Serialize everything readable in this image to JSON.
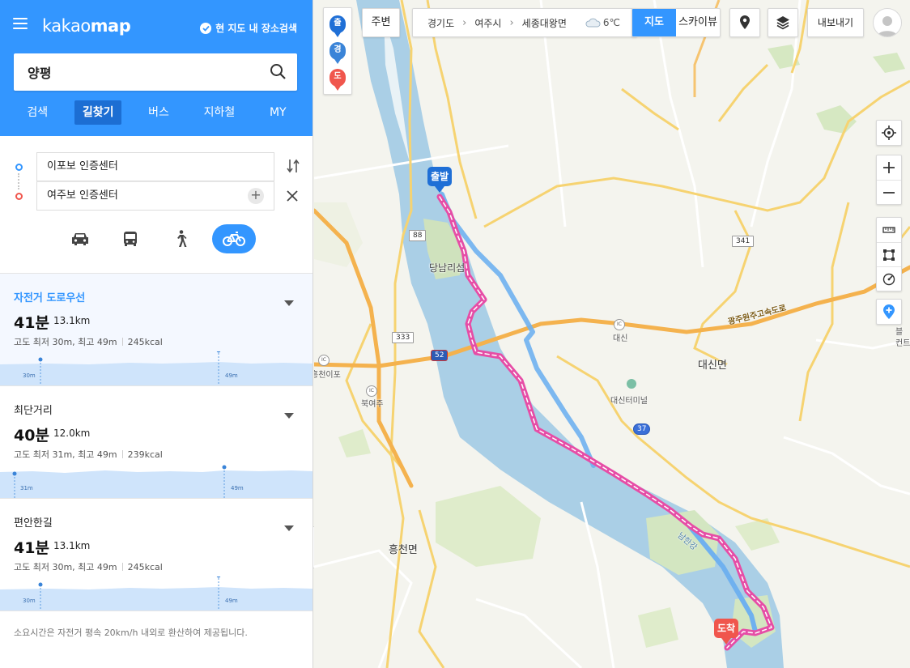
{
  "header": {
    "logo_light": "kakao",
    "logo_bold": "map",
    "search_here_label": "현 지도 내 장소검색"
  },
  "search": {
    "value": "양평"
  },
  "tabs": [
    {
      "label": "검색",
      "active": false
    },
    {
      "label": "길찾기",
      "active": true
    },
    {
      "label": "버스",
      "active": false
    },
    {
      "label": "지하철",
      "active": false
    },
    {
      "label": "MY",
      "active": false
    }
  ],
  "route": {
    "origin": "이포보 인증센터",
    "destination": "여주보 인증센터"
  },
  "modes": [
    {
      "name": "car-icon",
      "active": false
    },
    {
      "name": "bus-icon",
      "active": false
    },
    {
      "name": "walk-icon",
      "active": false
    },
    {
      "name": "bike-icon",
      "active": true
    }
  ],
  "results": [
    {
      "title": "자전거 도로우선",
      "time": "41분",
      "distance": "13.1km",
      "elevation": "고도 최저 30m, 최고 49m",
      "kcal": "245kcal",
      "min_label": "30m",
      "max_label": "49m",
      "selected": true
    },
    {
      "title": "최단거리",
      "time": "40분",
      "distance": "12.0km",
      "elevation": "고도 최저 31m, 최고 49m",
      "kcal": "239kcal",
      "min_label": "31m",
      "max_label": "49m",
      "selected": false
    },
    {
      "title": "편안한길",
      "time": "41분",
      "distance": "13.1km",
      "elevation": "고도 최저 30m, 최고 49m",
      "kcal": "245kcal",
      "min_label": "30m",
      "max_label": "49m",
      "selected": false
    }
  ],
  "footnote": "소요시간은 자전거 평속 20km/h 내외로 환산하여 제공됩니다.",
  "map_toolbar": {
    "pin_legend": [
      "출",
      "경",
      "도"
    ],
    "nearby_label": "주변",
    "breadcrumb": [
      "경기도",
      "여주시",
      "세종대왕면"
    ],
    "temperature": "6℃",
    "maptype_map": "지도",
    "maptype_sky": "스카이뷰",
    "export_label": "내보내기"
  },
  "map": {
    "start_label": "출발",
    "end_label": "도착",
    "places": {
      "dangnamri": "당남리섬",
      "daesin_ic": "대신",
      "daesin_myeon": "대신면",
      "daesin_terminal": "대신터미널",
      "heungcheon_ipo": "흥천이포",
      "bukyeoju": "북여주",
      "heungcheon_myeon": "흥천면",
      "namhan_river": "남한강",
      "expressway": "광주원주고속도로",
      "right_edge": "블\n컨트"
    },
    "roads": {
      "r88": "88",
      "r333": "333",
      "r52": "52",
      "r341": "341",
      "r37": "37"
    },
    "ic": "IC"
  },
  "colors": {
    "brand": "#3396ff",
    "route_pink": "#e64da6",
    "alt_route_blue": "#6fb1ef",
    "start_blue": "#1f6fd6",
    "end_red": "#f0564d"
  }
}
